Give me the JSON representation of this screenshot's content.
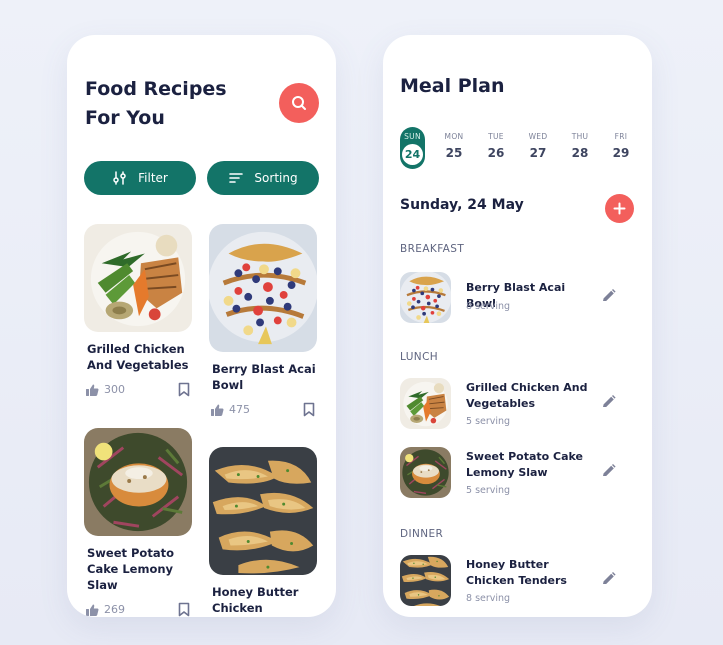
{
  "recipes_screen": {
    "title": "Food Recipes For You",
    "filter_label": "Filter",
    "sorting_label": "Sorting",
    "cards": [
      {
        "title": "Grilled Chicken And Vegetables",
        "likes": "300"
      },
      {
        "title": "Berry Blast Acai Bowl",
        "likes": "475"
      },
      {
        "title": "Sweet Potato Cake Lemony Slaw",
        "likes": "269"
      },
      {
        "title": "Honey Butter Chicken Tenders",
        "likes": ""
      }
    ]
  },
  "meal_plan_screen": {
    "title": "Meal Plan",
    "days": [
      {
        "name": "SUN",
        "date": "24",
        "selected": true
      },
      {
        "name": "MON",
        "date": "25"
      },
      {
        "name": "TUE",
        "date": "26"
      },
      {
        "name": "WED",
        "date": "27"
      },
      {
        "name": "THU",
        "date": "28"
      },
      {
        "name": "FRI",
        "date": "29"
      }
    ],
    "date_heading": "Sunday, 24 May",
    "breakfast": {
      "label": "BREAKFAST",
      "items": [
        {
          "name": "Berry Blast Acai Bowl",
          "serving": "8 serving"
        }
      ]
    },
    "lunch": {
      "label": "LUNCH",
      "items": [
        {
          "name": "Grilled Chicken And Vegetables",
          "serving": "5 serving"
        },
        {
          "name": "Sweet Potato Cake Lemony Slaw",
          "serving": "5 serving"
        }
      ]
    },
    "dinner": {
      "label": "DINNER",
      "items": [
        {
          "name": "Honey Butter Chicken Tenders",
          "serving": "8 serving"
        }
      ]
    }
  },
  "colors": {
    "primary_green": "#137468",
    "accent_red": "#f35f5c",
    "text_dark": "#1b2140",
    "text_muted": "#8c91a8",
    "background": "#eef1f9"
  },
  "icons": [
    "search-icon",
    "filter-icon",
    "sort-icon",
    "thumbs-up-icon",
    "bookmark-icon",
    "plus-icon",
    "pencil-icon"
  ]
}
